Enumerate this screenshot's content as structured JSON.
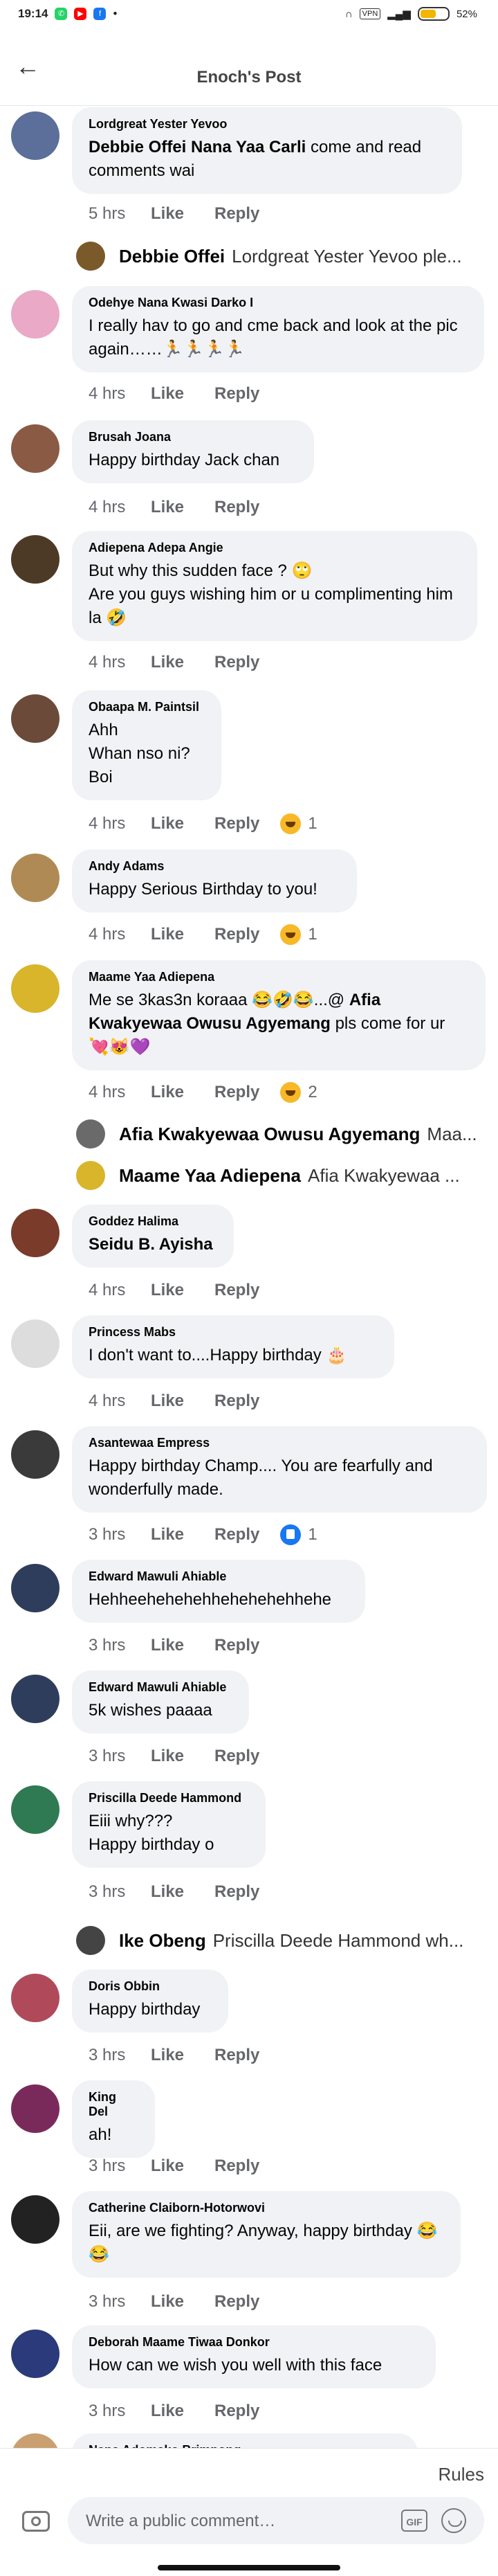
{
  "status_bar": {
    "time": "19:14",
    "battery": "52"
  },
  "header": {
    "back_label": "←",
    "title": "Enoch's Post"
  },
  "comments": [
    {
      "name": "Lordgreat Yester Yevoo",
      "mention": "Debbie Offei Nana Yaa Carli",
      "text": " come and read comments wai",
      "time": "5 hrs",
      "like": "Like",
      "reply": "Reply",
      "avatar_color": "#5b6f9a"
    },
    {
      "name": "Odehye Nana Kwasi Darko I",
      "text": "I really hav to go and cme back and look at the pic again……🏃🏃🏃🏃",
      "time": "4 hrs",
      "like": "Like",
      "reply": "Reply",
      "avatar_color": "#e9a9c7"
    },
    {
      "name": "Brusah Joana",
      "text": "Happy birthday Jack chan",
      "time": "4 hrs",
      "like": "Like",
      "reply": "Reply",
      "avatar_color": "#8a5a44"
    },
    {
      "name": "Adiepena Adepa Angie",
      "text": "But why this sudden face ? 🙄\nAre you guys wishing him or u complimenting him la 🤣",
      "time": "4 hrs",
      "like": "Like",
      "reply": "Reply",
      "avatar_color": "#4d3a26"
    },
    {
      "name": "Obaapa M. Paintsil",
      "text": "Ahh\nWhan nso ni?\nBoi",
      "time": "4 hrs",
      "like": "Like",
      "reply": "Reply",
      "reaction_count": "1",
      "avatar_color": "#6b4a3a"
    },
    {
      "name": "Andy Adams",
      "text": "Happy Serious Birthday to you!",
      "time": "4 hrs",
      "like": "Like",
      "reply": "Reply",
      "reaction_count": "1",
      "avatar_color": "#b08a55"
    },
    {
      "name": "Maame Yaa Adiepena",
      "text": "Me se 3kas3n koraaa 😂🤣😂...@ ",
      "mention": "Afia Kwakyewaa Owusu Agyemang",
      "text2": " pls come for ur 💘😻💜",
      "time": "4 hrs",
      "like": "Like",
      "reply": "Reply",
      "reaction_count": "2",
      "avatar_color": "#d8b52a"
    },
    {
      "name": "Goddez Halima",
      "mention": "Seidu B. Ayisha",
      "time": "4 hrs",
      "like": "Like",
      "reply": "Reply",
      "avatar_color": "#7a3b2a"
    },
    {
      "name": "Princess Mabs",
      "text": "I don't want to....Happy birthday 🎂",
      "time": "4 hrs",
      "like": "Like",
      "reply": "Reply",
      "avatar_color": "#dddddd"
    },
    {
      "name": "Asantewaa Empress",
      "text": "Happy birthday Champ.... You are fearfully and wonderfully made.",
      "time": "3 hrs",
      "like": "Like",
      "reply": "Reply",
      "reaction_count": "1",
      "avatar_color": "#3a3a3a"
    },
    {
      "name": "Edward Mawuli Ahiable",
      "text": "Hehheehehehehhehehehehhehe",
      "time": "3 hrs",
      "like": "Like",
      "reply": "Reply",
      "avatar_color": "#2f3d5c"
    },
    {
      "name": "Edward Mawuli Ahiable",
      "text": "5k wishes paaaa",
      "time": "3 hrs",
      "like": "Like",
      "reply": "Reply",
      "avatar_color": "#2f3d5c"
    },
    {
      "name": "Priscilla Deede Hammond",
      "text": "Eiii why???\nHappy birthday o",
      "time": "3 hrs",
      "like": "Like",
      "reply": "Reply",
      "avatar_color": "#2f7a52"
    },
    {
      "name": "Doris Obbin",
      "text": "Happy birthday",
      "time": "3 hrs",
      "like": "Like",
      "reply": "Reply",
      "avatar_color": "#b04a5a"
    },
    {
      "name": "King Del",
      "text": "ah!",
      "time": "3 hrs",
      "like": "Like",
      "reply": "Reply",
      "avatar_color": "#7a2a5a"
    },
    {
      "name": "Catherine Claiborn-Hotorwovi",
      "text": "Eii, are we fighting? Anyway, happy birthday 😂😂",
      "time": "3 hrs",
      "like": "Like",
      "reply": "Reply",
      "avatar_color": "#222222"
    },
    {
      "name": "Deborah Maame Tiwaa Donkor",
      "text": "How can we wish you well with this face",
      "time": "3 hrs",
      "like": "Like",
      "reply": "Reply",
      "avatar_color": "#2a3a7a"
    },
    {
      "name": "Nana Adomako Brimpong",
      "avatar_color": "#caa070"
    }
  ],
  "replies": [
    {
      "name": "Debbie Offei",
      "text": "Lordgreat Yester Yevoo ple...",
      "avatar_color": "#7a5a2a"
    },
    {
      "name": "Afia Kwakyewaa Owusu Agyemang",
      "text": "Maa...",
      "avatar_color": "#6a6a6a"
    },
    {
      "name": "Maame Yaa Adiepena",
      "text": "Afia Kwakyewaa ...",
      "avatar_color": "#d8b52a"
    },
    {
      "name": "Ike Obeng",
      "text": "Priscilla Deede Hammond wh...",
      "avatar_color": "#444444"
    }
  ],
  "composer": {
    "rules_label": "Rules",
    "placeholder": "Write a public comment…",
    "gif_label": "GIF"
  }
}
